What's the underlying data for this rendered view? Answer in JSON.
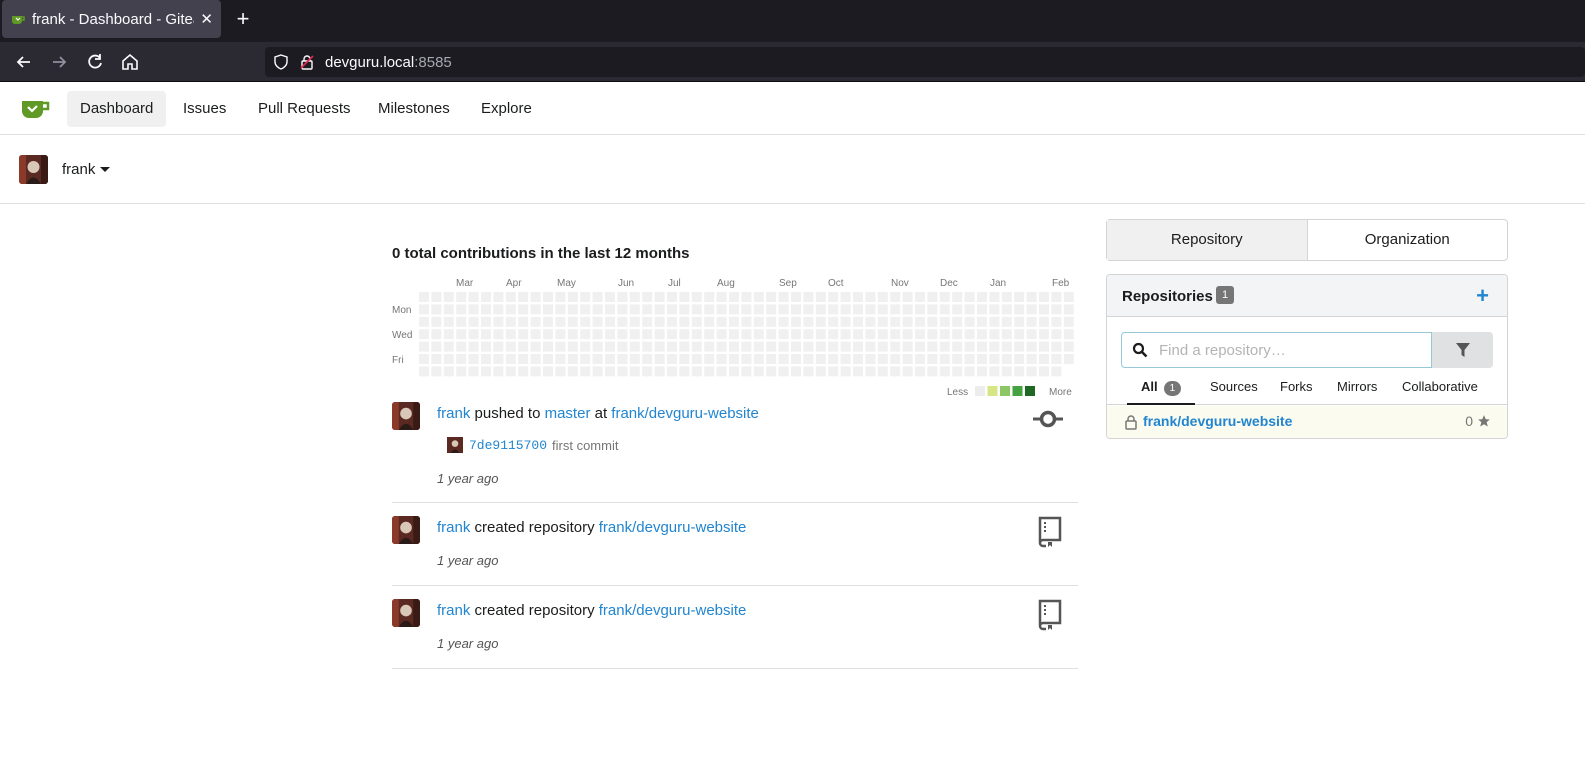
{
  "browser": {
    "tab_title": "frank - Dashboard - Gitea",
    "url_host": "devguru.local",
    "url_port": ":8585"
  },
  "nav": {
    "items": [
      "Dashboard",
      "Issues",
      "Pull Requests",
      "Milestones",
      "Explore"
    ],
    "active": "Dashboard"
  },
  "context": {
    "user": "frank"
  },
  "heatmap": {
    "title": "0 total contributions in the last 12 months",
    "months": [
      "Mar",
      "Apr",
      "May",
      "Jun",
      "Jul",
      "Aug",
      "Sep",
      "Oct",
      "Nov",
      "Dec",
      "Jan",
      "Feb"
    ],
    "days": [
      "Mon",
      "Wed",
      "Fri"
    ],
    "legend_less": "Less",
    "legend_more": "More",
    "colors": [
      "#ededed",
      "#d6e685",
      "#8cc665",
      "#44a340",
      "#1e6823"
    ]
  },
  "feed": {
    "items": [
      {
        "user": "frank",
        "action": "pushed to",
        "branch": "master",
        "at": "at",
        "repo": "frank/devguru-website",
        "commit_sha": "7de9115700",
        "commit_msg": "first commit",
        "time": "1 year ago",
        "icon": "git-commit-icon"
      },
      {
        "user": "frank",
        "action": "created repository",
        "repo": "frank/devguru-website",
        "time": "1 year ago",
        "icon": "repo-book-icon"
      },
      {
        "user": "frank",
        "action": "created repository",
        "repo": "frank/devguru-website",
        "time": "1 year ago",
        "icon": "repo-book-icon"
      }
    ]
  },
  "panel": {
    "switch": [
      "Repository",
      "Organization"
    ],
    "title": "Repositories",
    "count": "1",
    "search_placeholder": "Find a repository…",
    "tabs": [
      "All",
      "Sources",
      "Forks",
      "Mirrors",
      "Collaborative"
    ],
    "all_count": "1",
    "repos": [
      {
        "name": "frank/devguru-website",
        "stars": "0",
        "private": true
      }
    ]
  }
}
